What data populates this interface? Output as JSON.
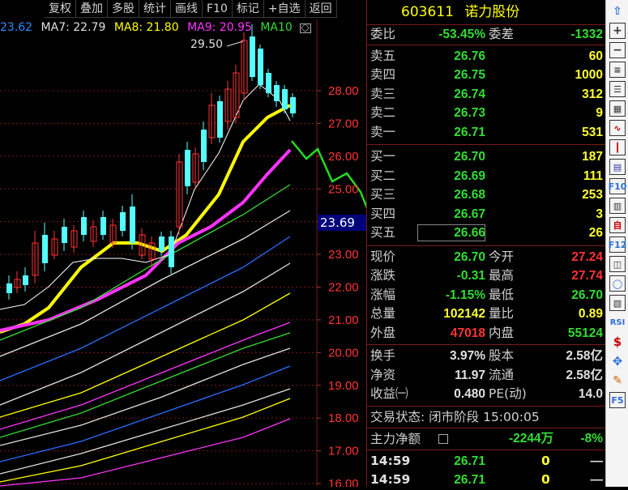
{
  "toolbar": [
    "复权",
    "叠加",
    "多股",
    "统计",
    "画线",
    "F10",
    "标记",
    "+自选",
    "返回"
  ],
  "ma_bar": {
    "ma6_value": "23.62",
    "ma7": "MA7: 22.79",
    "ma8": "MA8: 21.80",
    "ma9": "MA9: 20.95",
    "ma10": "MA10",
    "diamond": "◇"
  },
  "chart": {
    "high_marker": "29.50",
    "current_price_tag": "23.69",
    "y_ticks": [
      "28.00",
      "27.00",
      "26.00",
      "25.00",
      "24.00",
      "23.00",
      "22.00",
      "21.00",
      "20.00",
      "19.00",
      "18.00",
      "17.00",
      "16.00"
    ]
  },
  "stock": {
    "code": "603611",
    "name": "诺力股份"
  },
  "weibi": {
    "label1": "委比",
    "value1": "-53.45%",
    "label2": "委差",
    "value2": "-1332"
  },
  "sell_orders": [
    {
      "label": "卖五",
      "price": "26.76",
      "volume": "60"
    },
    {
      "label": "卖四",
      "price": "26.75",
      "volume": "1000"
    },
    {
      "label": "卖三",
      "price": "26.74",
      "volume": "312"
    },
    {
      "label": "卖二",
      "price": "26.73",
      "volume": "9"
    },
    {
      "label": "卖一",
      "price": "26.71",
      "volume": "531"
    }
  ],
  "buy_orders": [
    {
      "label": "买一",
      "price": "26.70",
      "volume": "187"
    },
    {
      "label": "买二",
      "price": "26.69",
      "volume": "111"
    },
    {
      "label": "买三",
      "price": "26.68",
      "volume": "253"
    },
    {
      "label": "买四",
      "price": "26.67",
      "volume": "3"
    },
    {
      "label": "买五",
      "price": "26.66",
      "volume": "26"
    }
  ],
  "quote": [
    {
      "l1": "现价",
      "v1": "26.70",
      "l2": "今开",
      "v2": "27.24"
    },
    {
      "l1": "涨跌",
      "v1": "-0.31",
      "l2": "最高",
      "v2": "27.74"
    },
    {
      "l1": "涨幅",
      "v1": "-1.15%",
      "l2": "最低",
      "v2": "26.70"
    },
    {
      "l1": "总量",
      "v1": "102142",
      "l2": "量比",
      "v2": "0.89"
    },
    {
      "l1": "外盘",
      "v1": "47018",
      "l2": "内盘",
      "v2": "55124"
    }
  ],
  "stats": [
    {
      "l1": "换手",
      "v1": "3.97%",
      "l2": "股本",
      "v2": "2.58亿"
    },
    {
      "l1": "净资",
      "v1": "11.97",
      "l2": "流通",
      "v2": "2.58亿"
    },
    {
      "l1": "收益㈠",
      "v1": "0.480",
      "l2": "PE(动)",
      "v2": "14.0"
    }
  ],
  "trade_status": "交易状态: 闭市阶段 15:00:05",
  "main_force": {
    "label": "主力净额",
    "value": "-2244万",
    "pct": "-8%"
  },
  "ticks": [
    {
      "time": "14:59",
      "price": "26.71",
      "vol": "0",
      "dir": "—"
    },
    {
      "time": "14:59",
      "price": "26.71",
      "vol": "0",
      "dir": "—"
    }
  ],
  "side_icons": [
    "arrow-up-icon",
    "box-plus-icon",
    "box-minus-icon",
    "doc-icon",
    "list-icon",
    "grid-icon",
    "line-chart-icon",
    "candle-icon",
    "table-icon",
    "f10-icon",
    "layers-icon",
    "self-select-icon",
    "f12-icon",
    "cube-icon",
    "circle-icon",
    "stack-icon",
    "rsi-icon",
    "dollar-icon",
    "move-icon",
    "pencil-icon",
    "f5-icon"
  ],
  "side_labels": {
    "f10": "F10",
    "self": "自",
    "f12": "F12",
    "rsi": "RSI",
    "dollar": "$",
    "f5": "F5"
  }
}
